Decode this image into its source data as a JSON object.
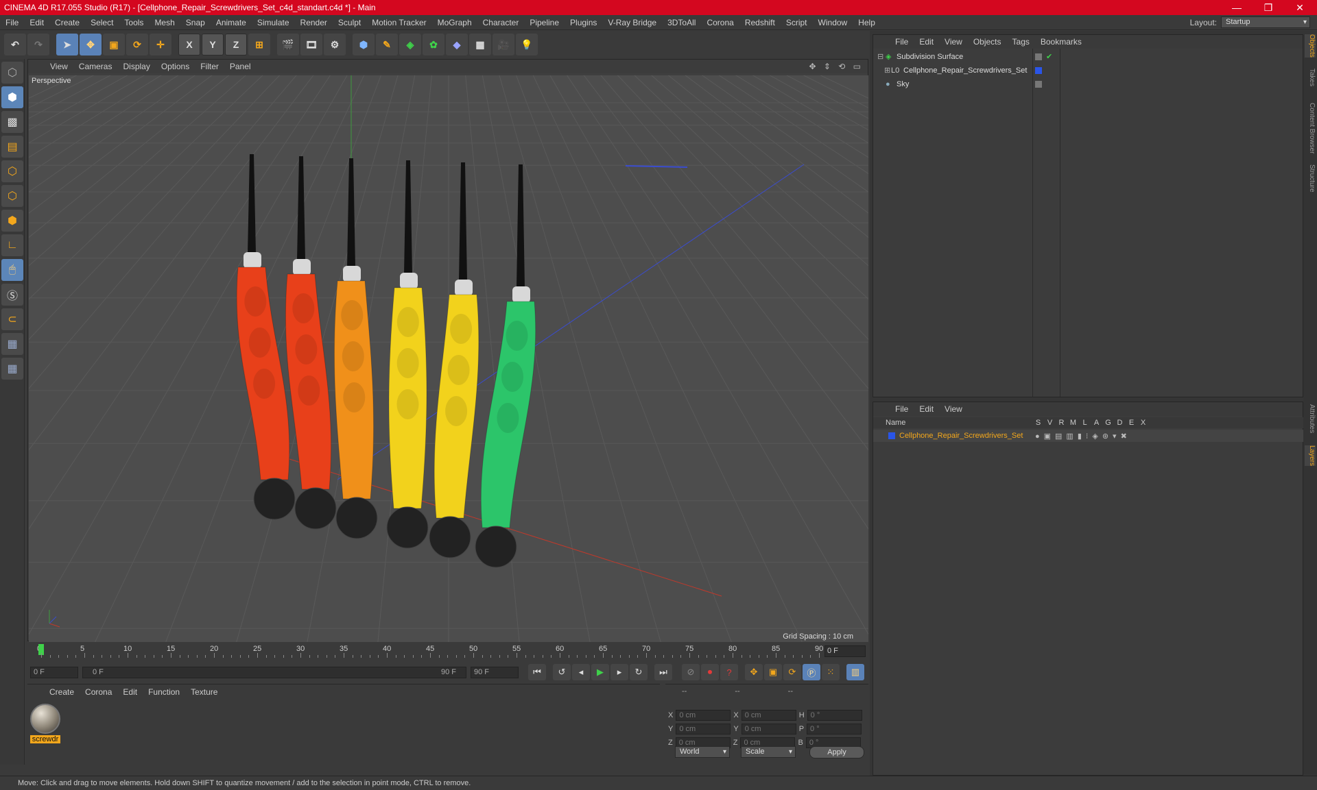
{
  "window": {
    "title": "CINEMA 4D R17.055 Studio (R17) - [Cellphone_Repair_Screwdrivers_Set_c4d_standart.c4d *] - Main",
    "minimize": "—",
    "maximize": "❐",
    "close": "✕"
  },
  "menubar": {
    "items": [
      "File",
      "Edit",
      "Create",
      "Select",
      "Tools",
      "Mesh",
      "Snap",
      "Animate",
      "Simulate",
      "Render",
      "Sculpt",
      "Motion Tracker",
      "MoGraph",
      "Character",
      "Pipeline",
      "Plugins",
      "V-Ray Bridge",
      "3DToAll",
      "Corona",
      "Redshift",
      "Script",
      "Window",
      "Help"
    ],
    "layout_label": "Layout:",
    "layout_value": "Startup"
  },
  "toolbar": {
    "axis_x": "X",
    "axis_y": "Y",
    "axis_z": "Z"
  },
  "viewport": {
    "menu": [
      "View",
      "Cameras",
      "Display",
      "Options",
      "Filter",
      "Panel"
    ],
    "label": "Perspective",
    "grid_spacing": "Grid Spacing : 10 cm",
    "screwdrivers": [
      {
        "color": "#e8401a"
      },
      {
        "color": "#e8401a"
      },
      {
        "color": "#f0901a"
      },
      {
        "color": "#f2d21c"
      },
      {
        "color": "#f2d21c"
      },
      {
        "color": "#2cc56a"
      }
    ]
  },
  "timeline": {
    "ticks": [
      "0",
      "5",
      "10",
      "15",
      "20",
      "25",
      "30",
      "35",
      "40",
      "45",
      "50",
      "55",
      "60",
      "65",
      "70",
      "75",
      "80",
      "85",
      "90"
    ],
    "frame": "0 F"
  },
  "transport": {
    "start": "0 F",
    "range_start": "0 F",
    "range_end": "90 F",
    "end": "90 F"
  },
  "materials": {
    "menu": [
      "Create",
      "Corona",
      "Edit",
      "Function",
      "Texture"
    ],
    "items": [
      {
        "name": "screwdr"
      }
    ]
  },
  "coords": {
    "header": [
      "--",
      "--",
      "--"
    ],
    "rows": [
      {
        "a": "X",
        "v1": "0 cm",
        "b": "X",
        "v2": "0 cm",
        "c": "H",
        "v3": "0 °"
      },
      {
        "a": "Y",
        "v1": "0 cm",
        "b": "Y",
        "v2": "0 cm",
        "c": "P",
        "v3": "0 °"
      },
      {
        "a": "Z",
        "v1": "0 cm",
        "b": "Z",
        "v2": "0 cm",
        "c": "B",
        "v3": "0 °"
      }
    ],
    "world": "World",
    "scale": "Scale",
    "apply": "Apply"
  },
  "objects": {
    "menu": [
      "File",
      "Edit",
      "View",
      "Objects",
      "Tags",
      "Bookmarks"
    ],
    "rows": [
      {
        "name": "Subdivision Surface"
      },
      {
        "name": "Cellphone_Repair_Screwdrivers_Set"
      },
      {
        "name": "Sky"
      }
    ]
  },
  "layers": {
    "menu": [
      "File",
      "Edit",
      "View"
    ],
    "header_name": "Name",
    "cols": [
      "S",
      "V",
      "R",
      "M",
      "L",
      "A",
      "G",
      "D",
      "E",
      "X"
    ],
    "row": {
      "name": "Cellphone_Repair_Screwdrivers_Set"
    }
  },
  "sidetabs": [
    "Objects",
    "Takes",
    "Content Browser",
    "Structure",
    "Attributes",
    "Layers"
  ],
  "status": "Move: Click and drag to move elements. Hold down SHIFT to quantize movement / add to the selection in point mode, CTRL to remove."
}
